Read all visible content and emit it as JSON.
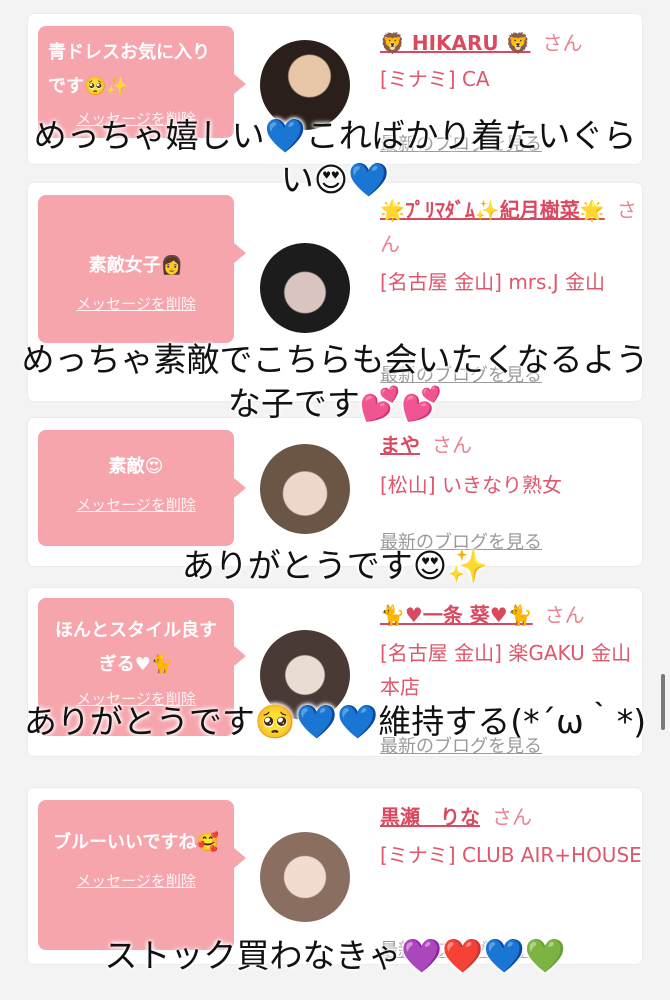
{
  "cards": [
    {
      "bubble_message": "青ドレスお気に入りです🥺✨",
      "delete_label": "メッセージを削除",
      "name": "🦁 HIKARU 🦁",
      "honorific": "さん",
      "shop": "[ミナミ] CA",
      "blog_label": "最新のブログを見る",
      "avatar_colors": [
        "#2a1f1a",
        "#e8c7a8"
      ]
    },
    {
      "bubble_message": "素敵女子👩",
      "delete_label": "メッセージを削除",
      "name": "🌟ﾌﾟﾘﾏﾀﾞﾑ✨紀月樹菜🌟",
      "honorific": "さん",
      "shop": "[名古屋 金山] mrs.J 金山",
      "blog_label": "最新のブログを見る",
      "avatar_colors": [
        "#1c1c1c",
        "#d9c4c0"
      ]
    },
    {
      "bubble_message": "素敵😍",
      "delete_label": "メッセージを削除",
      "name": "まや",
      "honorific": "さん",
      "shop": "[松山] いきなり熟女",
      "blog_label": "最新のブログを見る",
      "avatar_colors": [
        "#6b5646",
        "#efd6cc"
      ]
    },
    {
      "bubble_message": "ほんとスタイル良すぎる♥🐈",
      "delete_label": "メッセージを削除",
      "name": "🐈♥一条 葵♥🐈",
      "honorific": "さん",
      "shop": "[名古屋 金山] 楽GAKU 金山本店",
      "blog_label": "最新のブログを見る",
      "avatar_colors": [
        "#4a3a36",
        "#e9ddd3"
      ]
    },
    {
      "bubble_message": "ブルーいいですね🥰",
      "delete_label": "メッセージを削除",
      "name": "黒瀬　りな",
      "honorific": "さん",
      "shop": "[ミナミ] CLUB AIR+HOUSE",
      "blog_label": "最新のブログを見る",
      "avatar_colors": [
        "#8a6f60",
        "#f2dcd2"
      ]
    }
  ],
  "overlay_captions": [
    "めっちゃ嬉しい💙こればかり着たいぐらい😍💙",
    "めっちゃ素敵でこちらも会いたくなるような子です💕💕",
    "ありがとうです😍✨",
    "ありがとうです🥺💙💙維持する(*´ω｀*)",
    "ストック買わなきゃ💜❤️💙💚"
  ],
  "colors": {
    "bubble": "#f6a5ad",
    "name": "#d94a61",
    "page_bg": "#f3f3f3"
  }
}
